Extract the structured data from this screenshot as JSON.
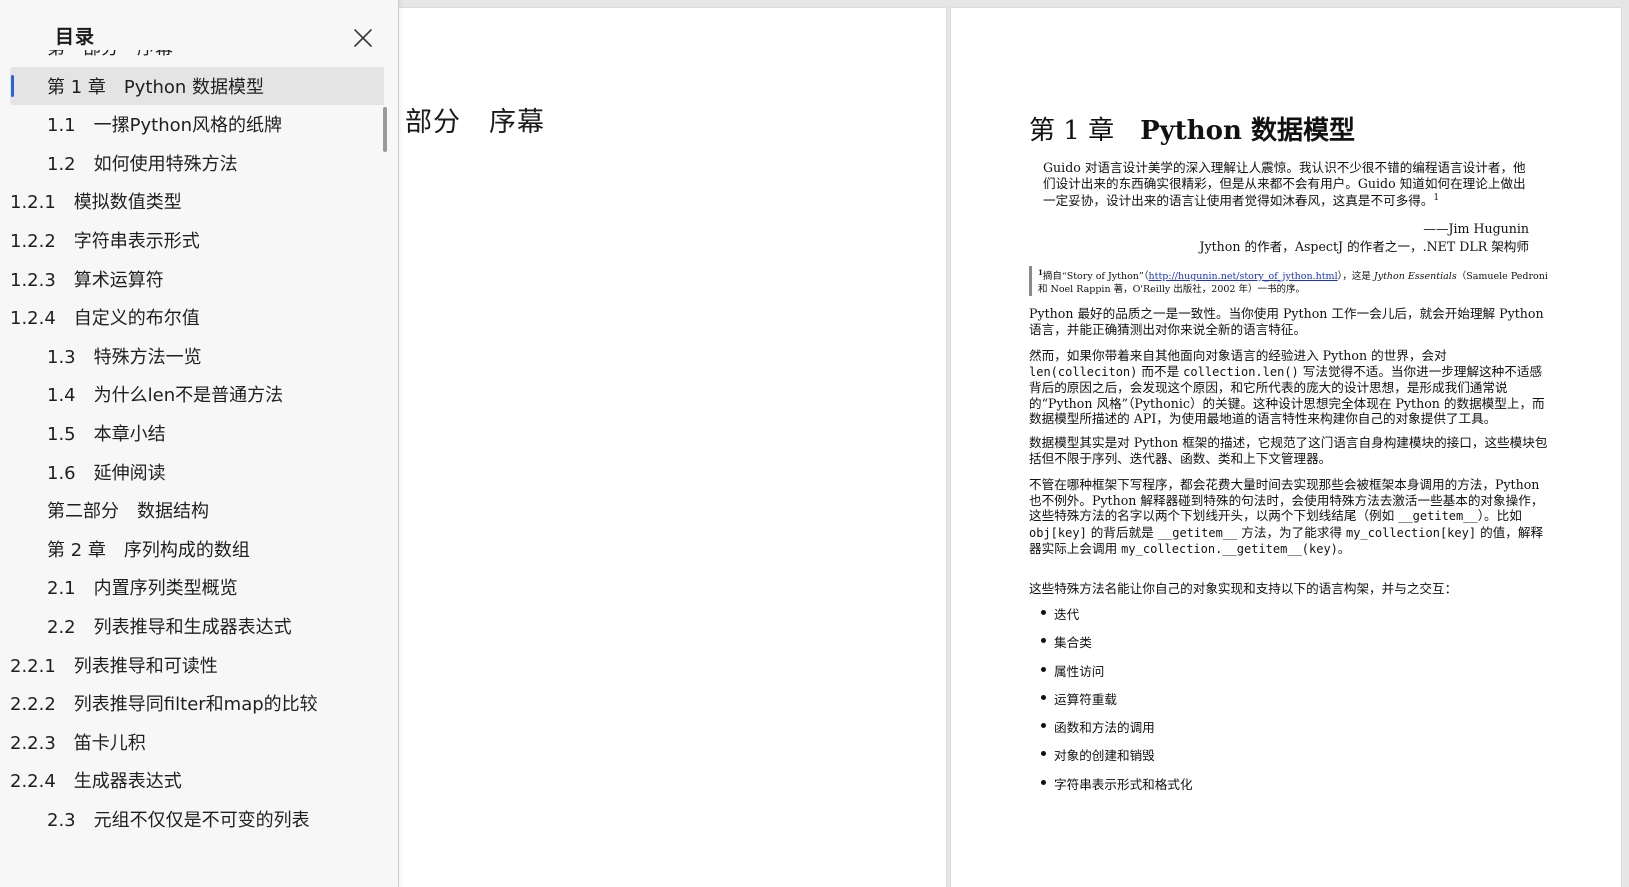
{
  "toc": {
    "title": "目录",
    "items": [
      {
        "label": "第一部分　序幕",
        "level": 0
      },
      {
        "label": "第 1 章　Python 数据模型",
        "level": 0,
        "active": true
      },
      {
        "label": "1.1　一摞Python风格的纸牌",
        "level": 1
      },
      {
        "label": "1.2　如何使用特殊方法",
        "level": 1
      },
      {
        "label": "1.2.1　模拟数值类型",
        "level": 2
      },
      {
        "label": "1.2.2　字符串表示形式",
        "level": 2
      },
      {
        "label": "1.2.3　算术运算符",
        "level": 2
      },
      {
        "label": "1.2.4　自定义的布尔值",
        "level": 2
      },
      {
        "label": "1.3　特殊方法一览",
        "level": 1
      },
      {
        "label": "1.4　为什么len不是普通方法",
        "level": 1
      },
      {
        "label": "1.5　本章小结",
        "level": 1
      },
      {
        "label": "1.6　延伸阅读",
        "level": 1
      },
      {
        "label": "第二部分　数据结构",
        "level": 0
      },
      {
        "label": "第 2 章　序列构成的数组",
        "level": 0
      },
      {
        "label": "2.1　内置序列类型概览",
        "level": 1
      },
      {
        "label": "2.2　列表推导和生成器表达式",
        "level": 1
      },
      {
        "label": "2.2.1　列表推导和可读性",
        "level": 2
      },
      {
        "label": "2.2.2　列表推导同filter和map的比较",
        "level": 2
      },
      {
        "label": "2.2.3　笛卡儿积",
        "level": 2
      },
      {
        "label": "2.2.4　生成器表达式",
        "level": 2
      },
      {
        "label": "2.3　元组不仅仅是不可变的列表",
        "level": 1
      }
    ]
  },
  "left_page": {
    "heading": "部分　序幕"
  },
  "right_page": {
    "chapter_prefix": "第 1 章　",
    "chapter_title": "Python 数据模型",
    "epigraph": "Guido 对语言设计美学的深入理解让人震惊。我认识不少很不错的编程语言设计者，他们设计出来的东西确实很精彩，但是从来都不会有用户。Guido 知道如何在理论上做出一定妥协，设计出来的语言让使用者觉得如沐春风，这真是不可多得。",
    "epigraph_note": "1",
    "attribution_name": "——Jim Hugunin",
    "attribution_role": "Jython 的作者，AspectJ 的作者之一，.NET DLR 架构师",
    "footnote": {
      "num": "1",
      "pre": "摘自“Story of Jython”（",
      "link": "http://hugunin.net/story_of_jython.html",
      "mid": "），这是 ",
      "book": "Jython Essentials",
      "post": "（Samuele Pedroni 和 Noel Rappin 著，O'Reilly 出版社，2002 年）一书的序。"
    },
    "p1": "Python 最好的品质之一是一致性。当你使用 Python 工作一会儿后，就会开始理解 Python 语言，并能正确猜测出对你来说全新的语言特征。",
    "p2": {
      "a": "然而，如果你带着来自其他面向对象语言的经验进入 Python 的世界，会对",
      "code1": "len(colleciton)",
      "b": " 而不是 ",
      "code2": "collection.len()",
      "c": " 写法觉得不适。当你进一步理解这种不适感背后的原因之后，会发现这个原因，和它所代表的庞大的设计思想，是形成我们通常说的“Python 风格”（Pythonic）的关键。这种设计思想完全体现在 Python 的数据模型上，而数据模型所描述的 API，为使用最地道的语言特性来构建你自己的对象提供了工具。"
    },
    "p3": "数据模型其实是对 Python 框架的描述，它规范了这门语言自身构建模块的接口，这些模块包括但不限于序列、迭代器、函数、类和上下文管理器。",
    "p4": {
      "a": "不管在哪种框架下写程序，都会花费大量时间去实现那些会被框架本身调用的方法，Python 也不例外。Python 解释器碰到特殊的句法时，会使用特殊方法去激活一些基本的对象操作，这些特殊方法的名字以两个下划线开头，以两个下划线结尾（例如 ",
      "code1": "__getitem__",
      "b": "）。比如 ",
      "code2": "obj[key]",
      "c": " 的背后就是 ",
      "code3": "__getitem__",
      "d": " 方法，为了能求得 ",
      "code4": "my_collection[key]",
      "e": " 的值，解释器实际上会调用 ",
      "code5": "my_collection.__getitem__(key)",
      "f": "。"
    },
    "p5": "这些特殊方法名能让你自己的对象实现和支持以下的语言构架，并与之交互：",
    "bullets": [
      "迭代",
      "集合类",
      "属性访问",
      "运算符重载",
      "函数和方法的调用",
      "对象的创建和销毁",
      "字符串表示形式和格式化"
    ]
  },
  "colors": {
    "accent": "#2b63d9",
    "sidebar_bg": "#f7f7f7",
    "active_row": "#e4e4e4",
    "link": "#1a33cc"
  },
  "icons": {
    "close": "close-icon"
  }
}
